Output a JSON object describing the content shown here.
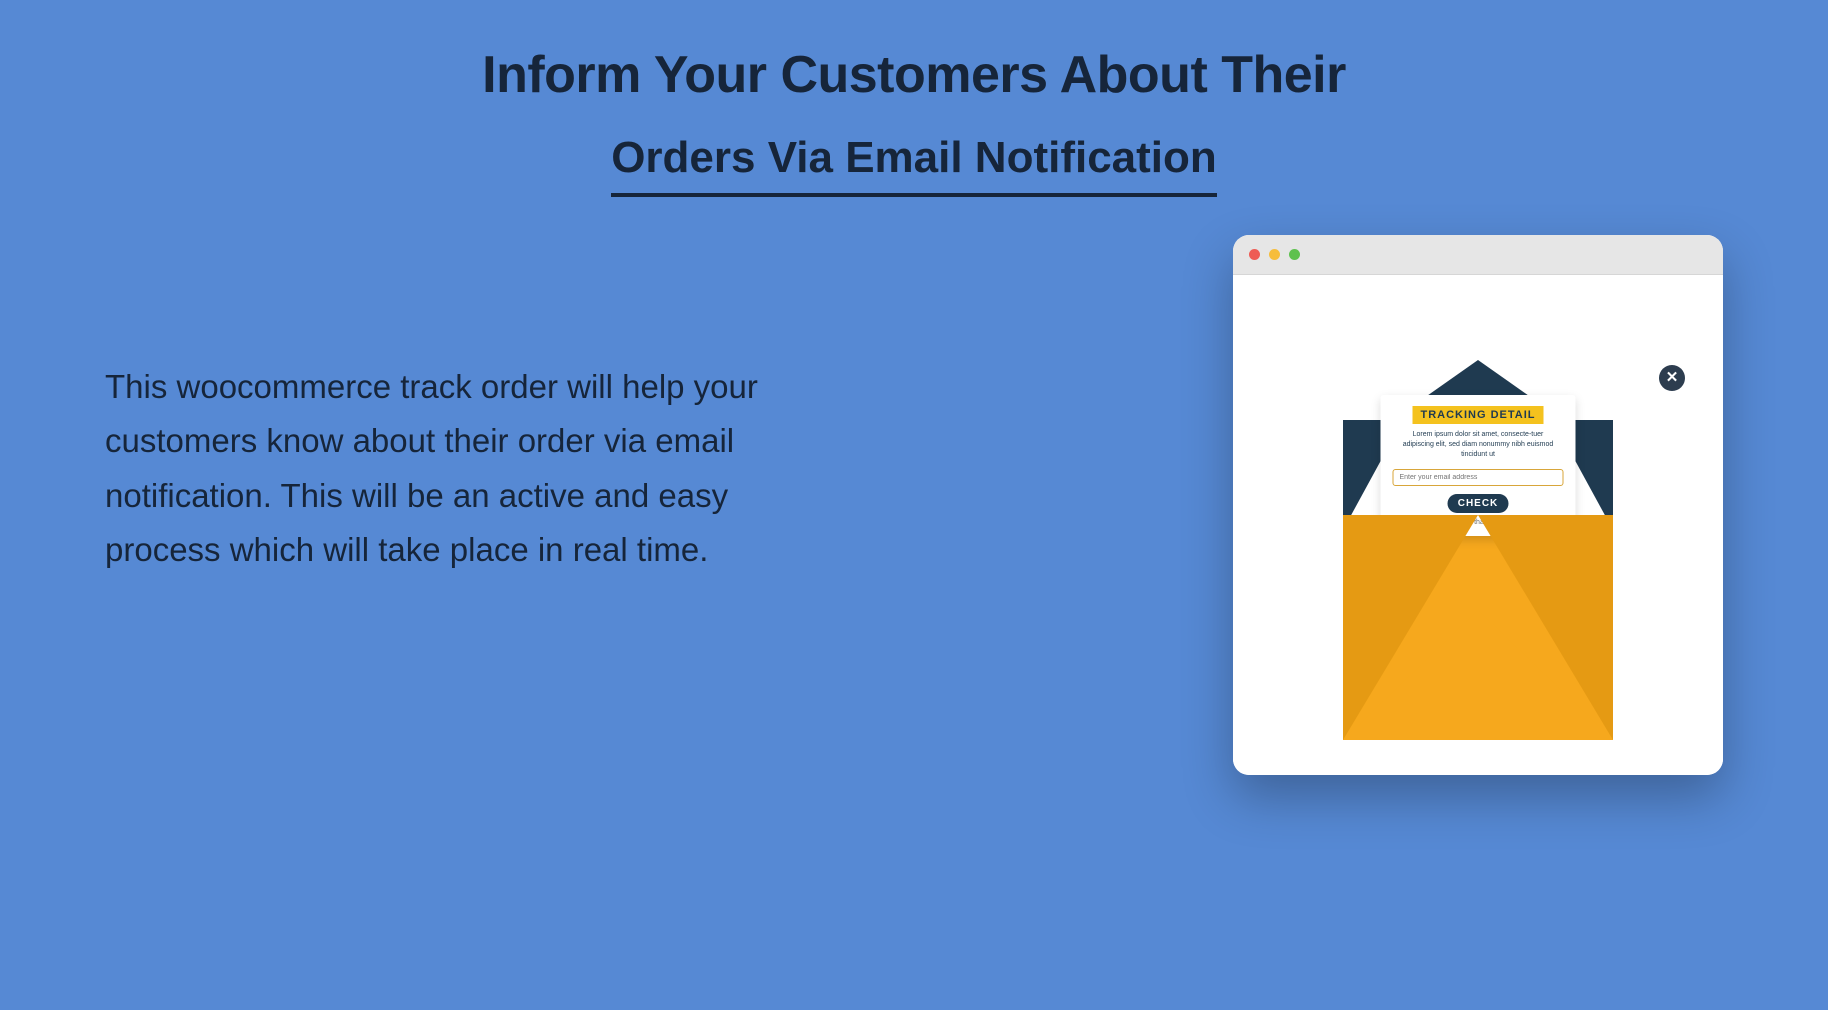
{
  "heading": {
    "line1": "Inform Your Customers About Their",
    "line2": "Orders Via Email Notification"
  },
  "description": "This woocommerce track order will help your customers know about their order via email notification. This will be an active and easy process which will take place in real time.",
  "letter": {
    "title": "TRACKING DETAIL",
    "text": "Lorem ipsum dolor sit amet, consecte-tuer adipiscing elit, sed diam nonummy nibh euismod tincidunt ut",
    "placeholder": "Enter your email address",
    "button": "CHECK",
    "no_thanks": "No, thanks"
  }
}
